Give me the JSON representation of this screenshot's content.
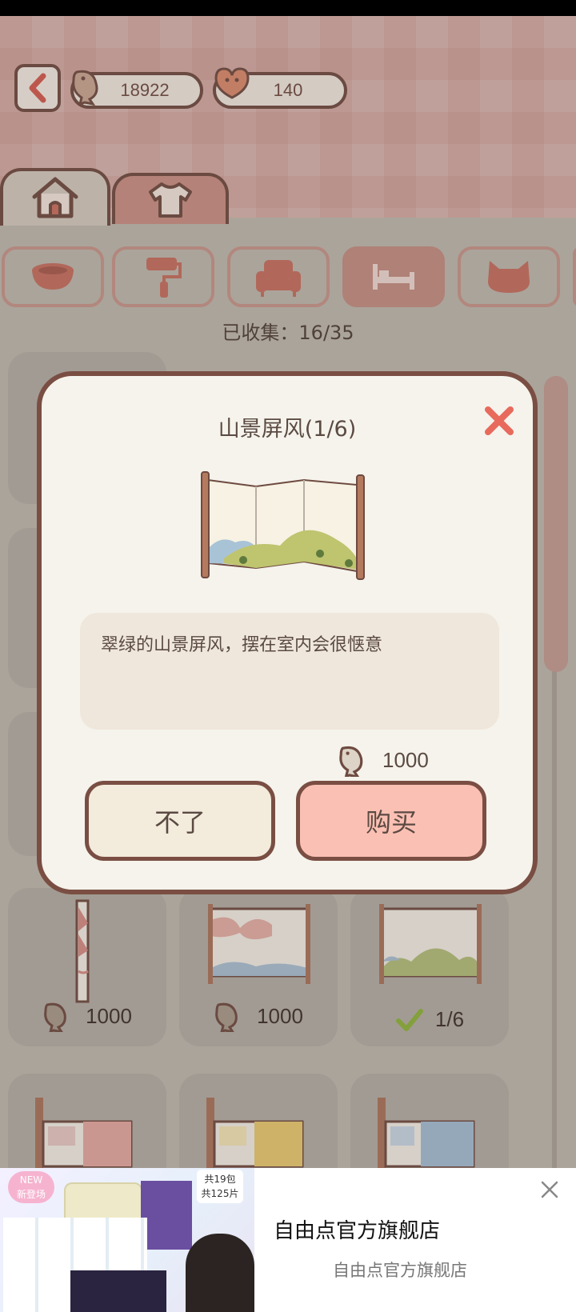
{
  "topbar": {
    "fish_coins": "18922",
    "hearts": "140"
  },
  "tabs": [
    {
      "label": "home-tab"
    },
    {
      "label": "clothes-tab"
    }
  ],
  "categories": [
    "bowl",
    "paint-roller",
    "armchair",
    "bed",
    "cat-bed"
  ],
  "collected_text": "已收集：16/35",
  "dialog": {
    "title": "山景屏风(1/6)",
    "description": "翠绿的山景屏风，摆在室内会很惬意",
    "price": "1000",
    "cancel_label": "不了",
    "buy_label": "购买"
  },
  "tiles": [
    {
      "price": "1000",
      "owned": false
    },
    {
      "price": "1000",
      "owned": false
    },
    {
      "price": "1/6",
      "owned": true
    }
  ],
  "ad": {
    "title": "自由点官方旗舰店",
    "subtitle": "自由点官方旗舰店",
    "badge_new": "NEW",
    "badge_new2": "新登场",
    "badge_count1": "共19包",
    "badge_count2": "共125片"
  },
  "colors": {
    "outline": "#7a4e43",
    "accent_pink": "#fbc0b4",
    "close_red": "#e86a5c",
    "check_green": "#8db33a"
  }
}
